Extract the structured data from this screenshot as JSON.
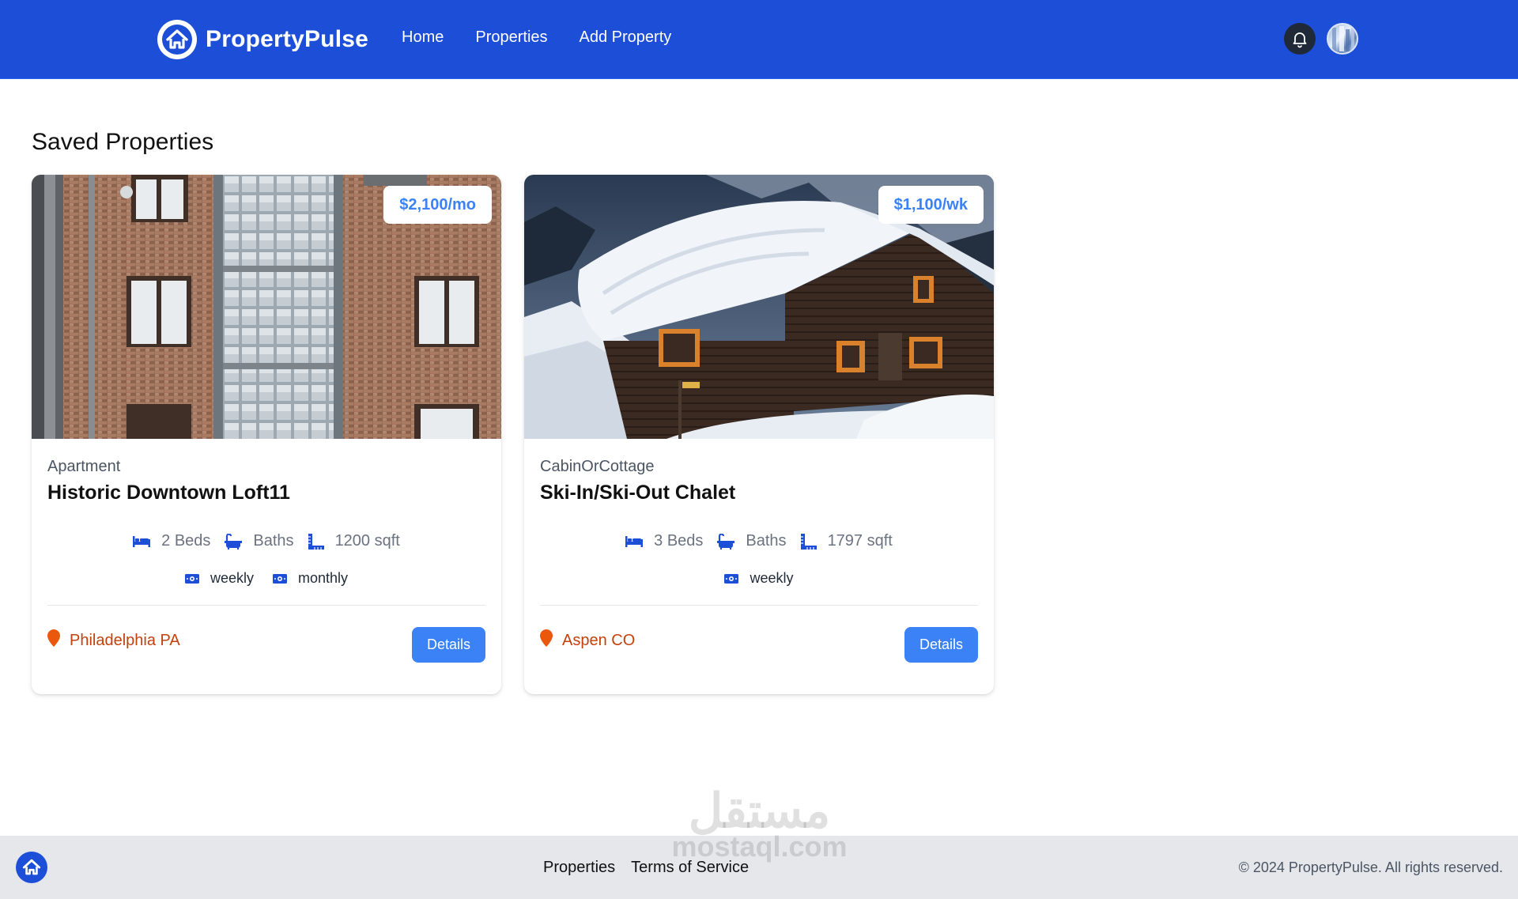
{
  "header": {
    "brand": "PropertyPulse",
    "nav": [
      {
        "label": "Home"
      },
      {
        "label": "Properties"
      },
      {
        "label": "Add Property"
      }
    ],
    "icons": {
      "logo": "house-icon",
      "notification": "bell-icon",
      "profile": "avatar-image"
    }
  },
  "main": {
    "title": "Saved Properties",
    "properties": [
      {
        "price": "$2,100/mo",
        "type": "Apartment",
        "name": "Historic Downtown Loft11",
        "beds": "2 Beds",
        "baths": "Baths",
        "sqft": "1200 sqft",
        "rates": [
          "weekly",
          "monthly"
        ],
        "location": "Philadelphia PA",
        "details_label": "Details"
      },
      {
        "price": "$1,100/wk",
        "type": "CabinOrCottage",
        "name": "Ski-In/Ski-Out Chalet",
        "beds": "3 Beds",
        "baths": "Baths",
        "sqft": "1797 sqft",
        "rates": [
          "weekly"
        ],
        "location": "Aspen CO",
        "details_label": "Details"
      }
    ]
  },
  "watermark": {
    "arabic": "مستقل",
    "latin": "mostaql.com"
  },
  "footer": {
    "links": [
      {
        "label": "Properties"
      },
      {
        "label": "Terms of Service"
      }
    ],
    "copyright": "© 2024 PropertyPulse. All rights reserved."
  },
  "colors": {
    "nav_bg": "#1d4ed8",
    "accent": "#3b82f6",
    "location": "#c2410c",
    "footer_bg": "#e5e7eb"
  }
}
